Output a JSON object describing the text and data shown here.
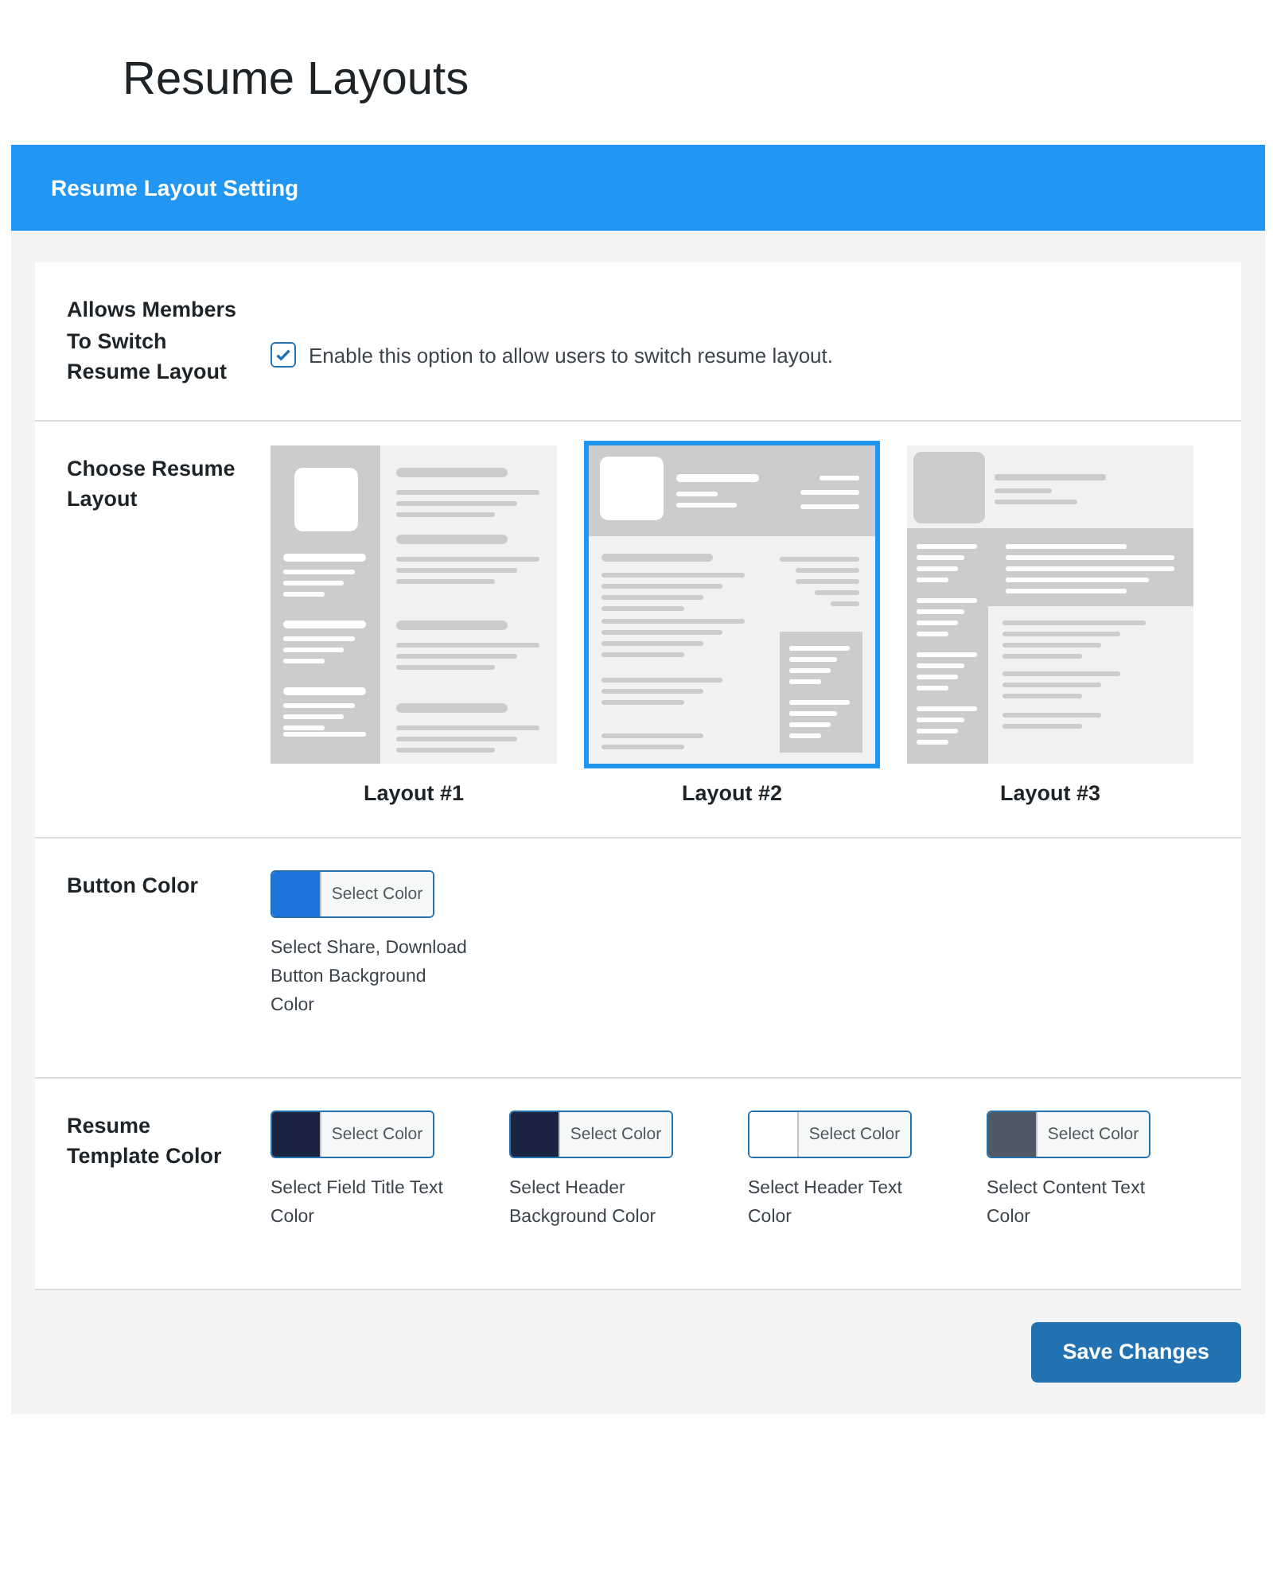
{
  "page_title": "Resume Layouts",
  "panel": {
    "title": "Resume Layout Setting"
  },
  "switch_setting": {
    "label": "Allows Members To Switch Resume Layout",
    "checked": true,
    "description": "Enable this option to allow users to switch resume layout."
  },
  "layout_setting": {
    "label": "Choose Resume Layout",
    "layouts": [
      {
        "kind": "sidebar",
        "caption": "Layout #1",
        "selected": false
      },
      {
        "kind": "header",
        "caption": "Layout #2",
        "selected": true
      },
      {
        "kind": "band",
        "caption": "Layout #3",
        "selected": false
      }
    ]
  },
  "button_color": {
    "label": "Button Color",
    "pickers": [
      {
        "button": "Select Color",
        "color": "#1e74d8",
        "description": "Select Share, Download Button Background Color"
      }
    ]
  },
  "template_color": {
    "label": "Resume Template Color",
    "pickers": [
      {
        "button": "Select Color",
        "color": "#1b2440",
        "description": "Select Field Title Text Color"
      },
      {
        "button": "Select Color",
        "color": "#1b2440",
        "description": "Select Header Background Color"
      },
      {
        "button": "Select Color",
        "color": "#ffffff",
        "description": "Select Header Text Color"
      },
      {
        "button": "Select Color",
        "color": "#4f5965",
        "description": "Select Content Text Color"
      }
    ]
  },
  "save_button": "Save Changes"
}
